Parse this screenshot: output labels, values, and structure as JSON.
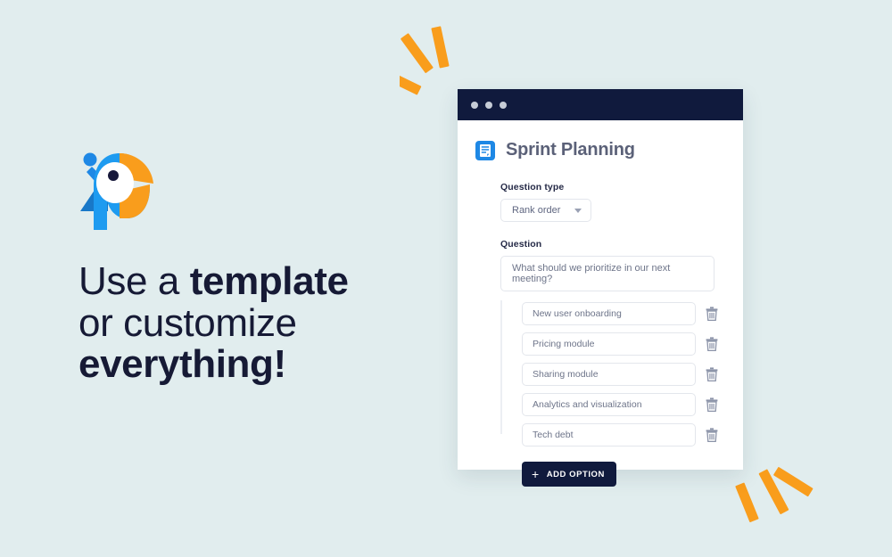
{
  "theme": {
    "background": "#e1edee",
    "accent_orange": "#f99d1c",
    "accent_blue": "#1e88e5",
    "dark_navy": "#101a3d",
    "text_navy": "#161a35"
  },
  "promo": {
    "logo_name": "parrot-logo",
    "headline_line1_plain": "Use a ",
    "headline_line1_bold": "template",
    "headline_line2": "or customize",
    "headline_line3_bold": "everything!"
  },
  "decorations": {
    "top_mark": "orange-sparkle-top",
    "bottom_mark": "orange-sparkle-bottom"
  },
  "window": {
    "titlebar": {
      "dots": [
        "dot-1",
        "dot-2",
        "dot-3"
      ]
    },
    "app_icon": "document-icon",
    "title": "Sprint Planning",
    "form": {
      "question_type_label": "Question type",
      "question_type_value": "Rank order",
      "question_label": "Question",
      "question_value": "What should we prioritize in our next meeting?",
      "options": [
        {
          "value": "New user onboarding",
          "delete_icon": "trash-icon"
        },
        {
          "value": "Pricing module",
          "delete_icon": "trash-icon"
        },
        {
          "value": "Sharing module",
          "delete_icon": "trash-icon"
        },
        {
          "value": "Analytics and visualization",
          "delete_icon": "trash-icon"
        },
        {
          "value": "Tech debt",
          "delete_icon": "trash-icon"
        }
      ],
      "add_option_label": "ADD OPTION",
      "add_option_icon": "plus-icon"
    }
  }
}
